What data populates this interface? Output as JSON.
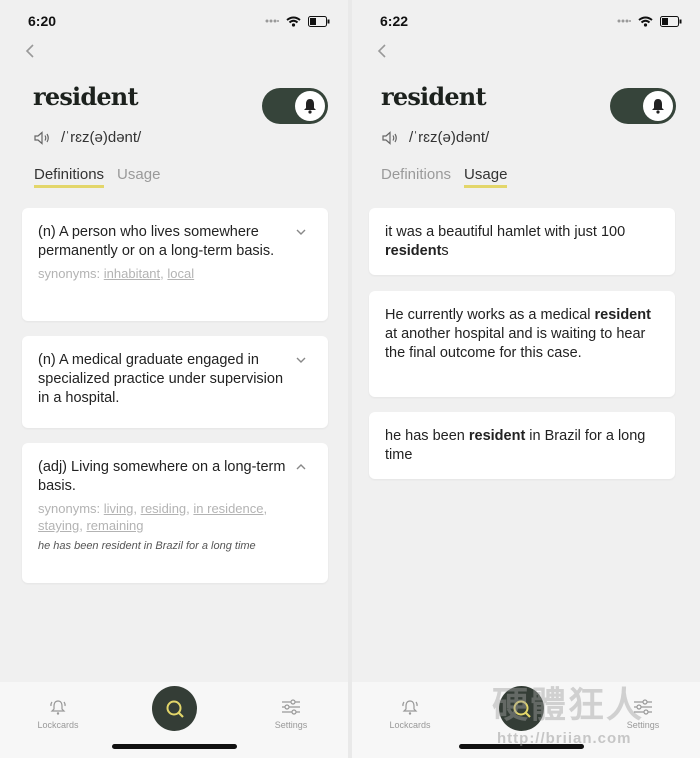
{
  "left": {
    "time": "6:20",
    "word": "resident",
    "pronunciation": "/ˈrɛz(ə)dənt/",
    "tabs": [
      "Definitions",
      "Usage"
    ],
    "active_tab": "Definitions",
    "definitions": [
      {
        "text": "(n) A person who lives somewhere permanently or on a long-term basis.",
        "synonyms_label": "synonyms:",
        "synonyms": [
          "inhabitant",
          "local"
        ],
        "chevron": "down"
      },
      {
        "text": "(n) A medical graduate engaged in specialized practice under supervision in a hospital.",
        "chevron": "down"
      },
      {
        "text": "(adj) Living somewhere on a long-term basis.",
        "synonyms_label": "synonyms:",
        "synonyms": [
          "living",
          "residing",
          "in residence",
          "staying",
          "remaining"
        ],
        "example": "he has been resident in Brazil for a long time",
        "chevron": "up"
      }
    ],
    "nav": {
      "lockcards": "Lockcards",
      "settings": "Settings"
    }
  },
  "right": {
    "time": "6:22",
    "word": "resident",
    "pronunciation": "/ˈrɛz(ə)dənt/",
    "tabs": [
      "Definitions",
      "Usage"
    ],
    "active_tab": "Usage",
    "usage": [
      {
        "before": "it was a beautiful hamlet with just 100 ",
        "bold": "resident",
        "after": "s"
      },
      {
        "before": "He currently works as a medical ",
        "bold": "resident",
        "after": " at another hospital and is waiting to hear the final outcome for this case."
      },
      {
        "before": "he has been ",
        "bold": "resident",
        "after": " in Brazil for a long time"
      }
    ],
    "nav": {
      "lockcards": "Lockcards",
      "settings": "Settings"
    }
  },
  "watermark": {
    "text": "硬體狂人",
    "url": "http://briian.com"
  },
  "colors": {
    "toggle": "#36443a",
    "tab_underline": "#e3d66a",
    "fab": "#343d36",
    "fab_icon": "#e3d66a"
  }
}
